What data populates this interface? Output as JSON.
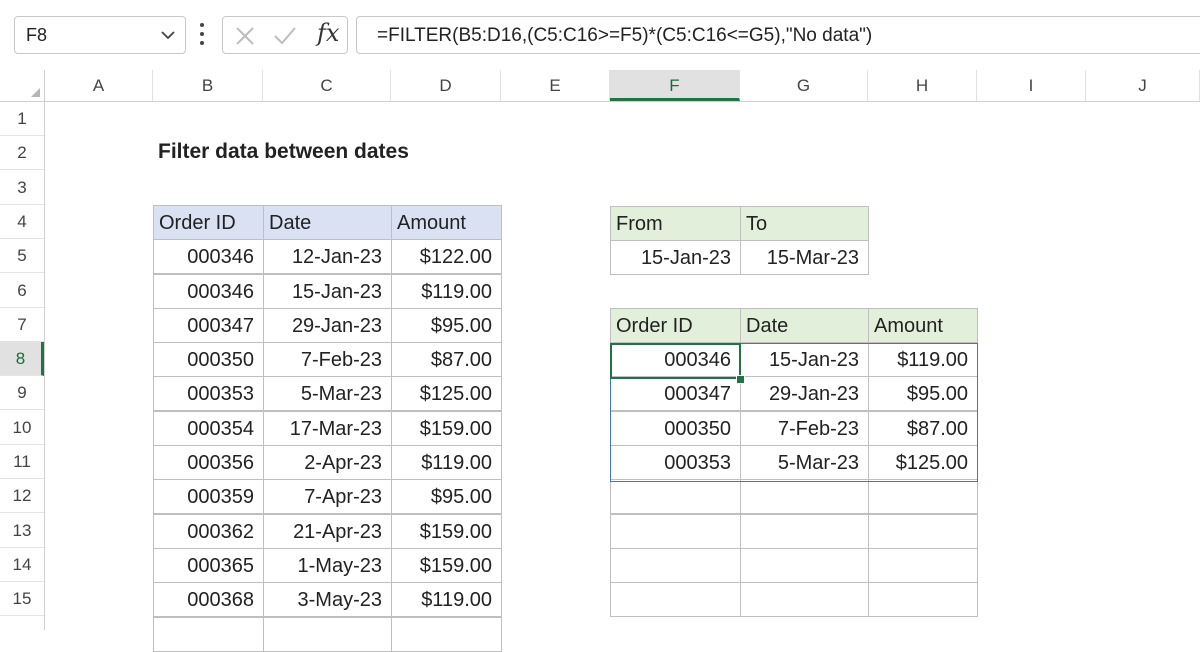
{
  "formula_bar": {
    "name_box": "F8",
    "fx_label": "fx",
    "formula": "=FILTER(B5:D16,(C5:C16>=F5)*(C5:C16<=G5),\"No data\")"
  },
  "columns": [
    "A",
    "B",
    "C",
    "D",
    "E",
    "F",
    "G",
    "H",
    "I",
    "J"
  ],
  "rows": [
    "1",
    "2",
    "3",
    "4",
    "5",
    "6",
    "7",
    "8",
    "9",
    "10",
    "11",
    "12",
    "13",
    "14",
    "15"
  ],
  "selected_cell": {
    "column": "F",
    "row": "8"
  },
  "title": "Filter data between dates",
  "source_table": {
    "headers": [
      "Order ID",
      "Date",
      "Amount"
    ],
    "rows": [
      [
        "000346",
        "12-Jan-23",
        "$122.00"
      ],
      [
        "000346",
        "15-Jan-23",
        "$119.00"
      ],
      [
        "000347",
        "29-Jan-23",
        "$95.00"
      ],
      [
        "000350",
        "7-Feb-23",
        "$87.00"
      ],
      [
        "000353",
        "5-Mar-23",
        "$125.00"
      ],
      [
        "000354",
        "17-Mar-23",
        "$159.00"
      ],
      [
        "000356",
        "2-Apr-23",
        "$119.00"
      ],
      [
        "000359",
        "7-Apr-23",
        "$95.00"
      ],
      [
        "000362",
        "21-Apr-23",
        "$159.00"
      ],
      [
        "000365",
        "1-May-23",
        "$159.00"
      ],
      [
        "000368",
        "3-May-23",
        "$119.00"
      ]
    ]
  },
  "criteria": {
    "from_label": "From",
    "to_label": "To",
    "from_value": "15-Jan-23",
    "to_value": "15-Mar-23"
  },
  "result_table": {
    "headers": [
      "Order ID",
      "Date",
      "Amount"
    ],
    "rows": [
      [
        "000346",
        "15-Jan-23",
        "$119.00"
      ],
      [
        "000347",
        "29-Jan-23",
        "$95.00"
      ],
      [
        "000350",
        "7-Feb-23",
        "$87.00"
      ],
      [
        "000353",
        "5-Mar-23",
        "$125.00"
      ]
    ],
    "empty_rows": 4
  },
  "colors": {
    "header_blue": "#d9e1f2",
    "header_green": "#e2efda",
    "selection_green": "#217346",
    "spill_border": "#4472c4"
  }
}
